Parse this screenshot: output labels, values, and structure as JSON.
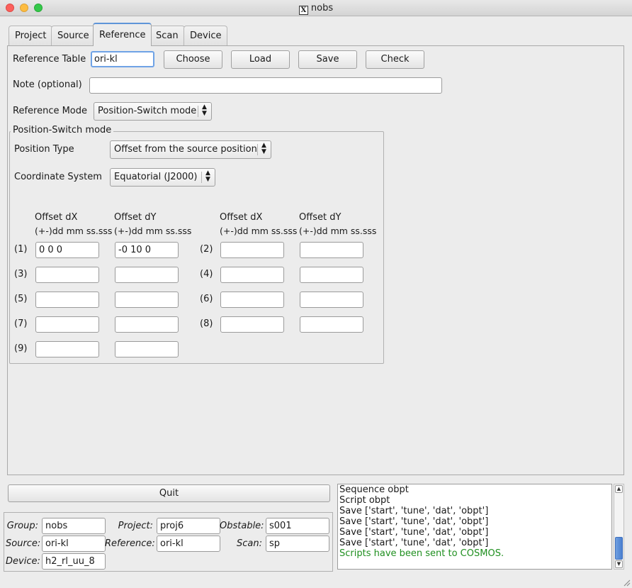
{
  "window": {
    "title": "nobs"
  },
  "tabs": [
    "Project",
    "Source",
    "Reference",
    "Scan",
    "Device"
  ],
  "reference": {
    "table_label": "Reference Table",
    "table_value": "ori-kl",
    "buttons": {
      "choose": "Choose",
      "load": "Load",
      "save": "Save",
      "check": "Check"
    },
    "note_label": "Note (optional)",
    "note_value": "",
    "mode_label": "Reference Mode",
    "mode_value": "Position-Switch mode"
  },
  "psw": {
    "title": "Position-Switch mode",
    "position_type_label": "Position Type",
    "position_type_value": "Offset from the source position",
    "coord_label": "Coordinate System",
    "coord_value": "Equatorial (J2000)",
    "headers": {
      "dx": "Offset dX",
      "dy": "Offset dY",
      "dx_fmt": "(+-)dd mm ss.sss",
      "dy_fmt": "(+-)dd mm ss.sss"
    },
    "offsets": [
      {
        "label": "(1)",
        "dx": "0 0 0",
        "dy": "-0 10 0"
      },
      {
        "label": "(2)",
        "dx": "",
        "dy": ""
      },
      {
        "label": "(3)",
        "dx": "",
        "dy": ""
      },
      {
        "label": "(4)",
        "dx": "",
        "dy": ""
      },
      {
        "label": "(5)",
        "dx": "",
        "dy": ""
      },
      {
        "label": "(6)",
        "dx": "",
        "dy": ""
      },
      {
        "label": "(7)",
        "dx": "",
        "dy": ""
      },
      {
        "label": "(8)",
        "dx": "",
        "dy": ""
      },
      {
        "label": "(9)",
        "dx": "",
        "dy": ""
      }
    ]
  },
  "bottom": {
    "quit": "Quit",
    "group_label": "Group:",
    "group_value": "nobs",
    "project_label": "Project:",
    "project_value": "proj6",
    "obstable_label": "Obstable:",
    "obstable_value": "s001",
    "source_label": "Source:",
    "source_value": "ori-kl",
    "reference_label": "Reference:",
    "reference_value": "ori-kl",
    "scan_label": "Scan:",
    "scan_value": "sp",
    "device_label": "Device:",
    "device_value": "h2_rl_uu_8"
  },
  "log": [
    "Sequence obpt",
    "Script obpt",
    "Save ['start', 'tune', 'dat', 'obpt']",
    "Save ['start', 'tune', 'dat', 'obpt']",
    "Save ['start', 'tune', 'dat', 'obpt']",
    "Save ['start', 'tune', 'dat', 'obpt']",
    "Scripts have been sent to COSMOS."
  ],
  "colors": {
    "accent": "#5e95d8",
    "success_text": "#1f8f1f"
  }
}
